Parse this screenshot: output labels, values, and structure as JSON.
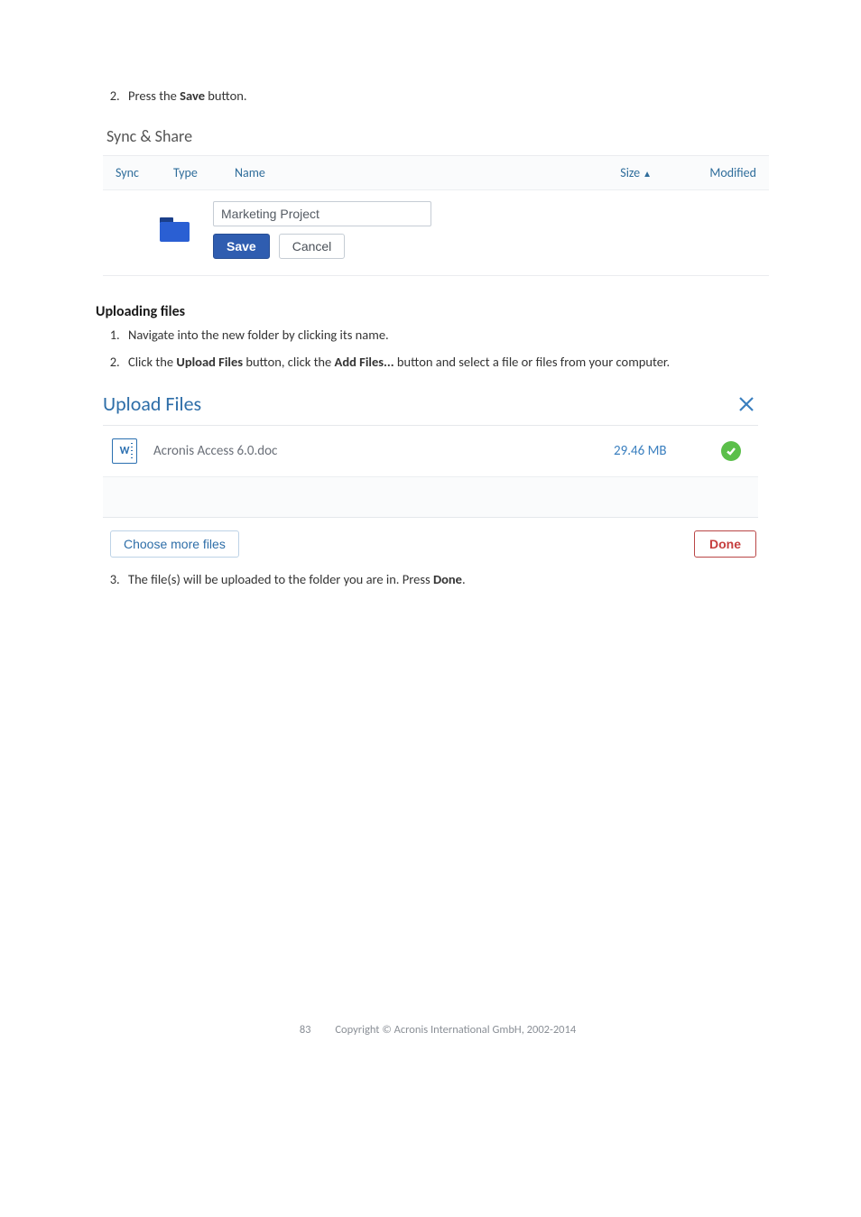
{
  "step2": {
    "num": "2.",
    "prefix": "Press the ",
    "bold": "Save",
    "suffix": " button."
  },
  "sync_share": {
    "title": "Sync & Share",
    "cols": {
      "sync": "Sync",
      "type": "Type",
      "name": "Name",
      "size": "Size",
      "sort_icon": "▲",
      "modified": "Modified"
    },
    "row": {
      "folder_name_value": "Marketing Project",
      "save": "Save",
      "cancel": "Cancel"
    }
  },
  "uploading": {
    "heading": "Uploading files",
    "s1": "Navigate into the new folder by clicking its name.",
    "s2_p1": "Click the ",
    "s2_b1": "Upload Files",
    "s2_p2": " button, click the ",
    "s2_b2": "Add Files...",
    "s2_p3": " button and select a file or files from your computer."
  },
  "upload_dialog": {
    "title": "Upload Files",
    "file": {
      "icon_label": "W",
      "name": "Acronis Access 6.0.doc",
      "size": "29.46 MB"
    },
    "choose_more": "Choose more files",
    "done": "Done"
  },
  "step3": {
    "prefix": "The file(s) will be uploaded to the folder you are in. Press ",
    "bold": "Done",
    "suffix": "."
  },
  "footer": {
    "page_num": "83",
    "copyright": "Copyright © Acronis International GmbH, 2002-2014"
  }
}
